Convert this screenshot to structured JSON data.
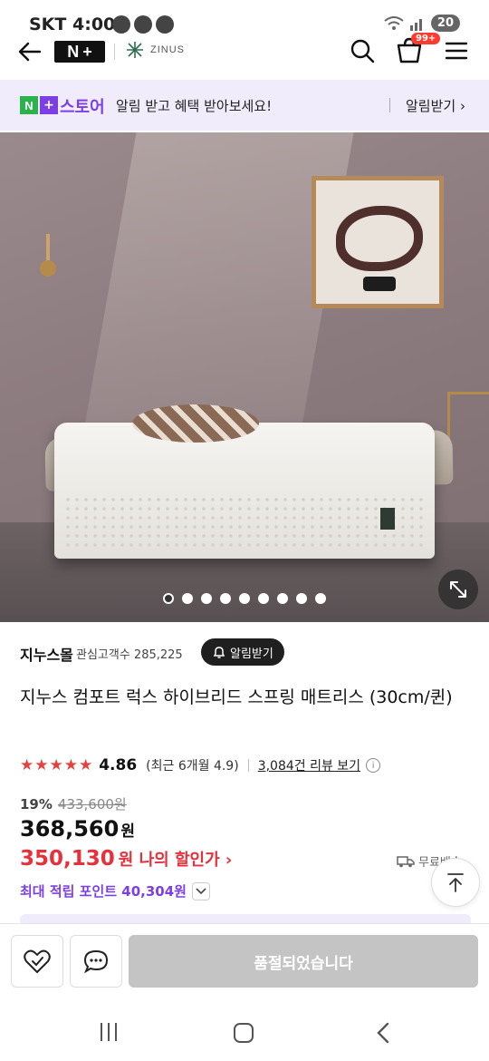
{
  "status_bar": {
    "carrier": "SKT",
    "time": "4:00",
    "battery": "20"
  },
  "header": {
    "nplus_logo_n": "N",
    "nplus_logo_plus": "+",
    "brand_logo_text": "ZINUS",
    "cart_badge": "99+"
  },
  "promo_banner": {
    "badge_n": "N",
    "badge_plus": "+",
    "store_label": "스토어",
    "message": "알림 받고 혜택 받아보세요!",
    "cta": "알림받기 ›"
  },
  "gallery": {
    "total_images": 9,
    "active_index": 0
  },
  "seller": {
    "name": "지누스몰",
    "fans": "관심고객수 285,225",
    "alarm_button": "알림받기"
  },
  "product": {
    "title": "지누스 컴포트 럭스 하이브리드 스프링 매트리스 (30cm/퀸)",
    "stars": "★★★★★",
    "rating": "4.86",
    "recent_rating": "(최근 6개월 4.9)",
    "reviews_link": "3,084건 리뷰 보기",
    "discount_rate": "19%",
    "original_price": "433,600원",
    "sale_price": "368,560",
    "sale_currency": "원",
    "my_price": "350,130",
    "my_price_label": "원 나의 할인가 ›",
    "shipping": "무료배송",
    "points": "최대 적립 포인트 40,304원"
  },
  "bottom_bar": {
    "soldout_label": "품절되었습니다"
  },
  "colors": {
    "accent_purple": "#7b3fe4",
    "naver_green": "#2bb24c",
    "price_red": "#e8303a",
    "star_red": "#e8403e",
    "soldout_gray": "#c4c4c4"
  }
}
